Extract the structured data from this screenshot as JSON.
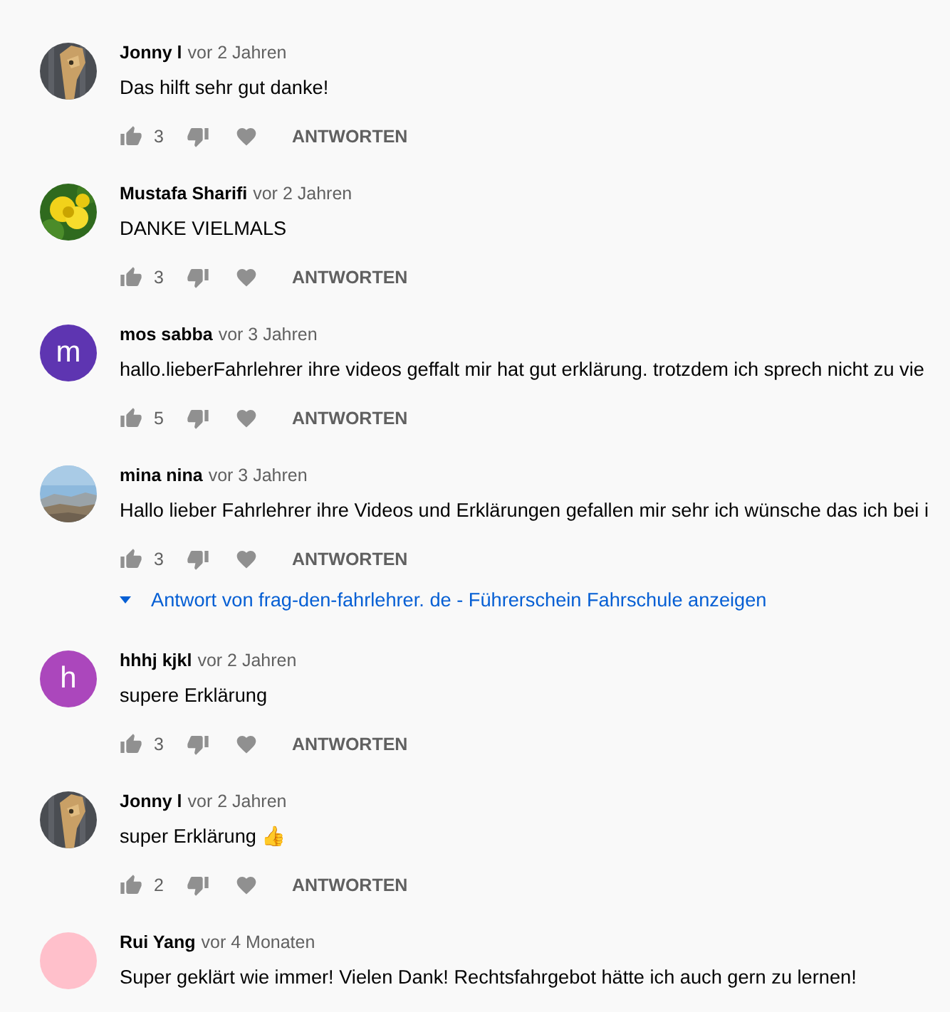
{
  "comments": [
    {
      "author": "Jonny l",
      "time": "vor 2 Jahren",
      "text": "Das hilft sehr gut danke!",
      "likes": "3",
      "reply_label": "ANTWORTEN"
    },
    {
      "author": "Mustafa Sharifi",
      "time": "vor 2 Jahren",
      "text": "DANKE VIELMALS",
      "likes": "3",
      "reply_label": "ANTWORTEN"
    },
    {
      "author": "mos sabba",
      "time": "vor 3 Jahren",
      "text": "hallo.lieberFahrlehrer ihre videos geffalt mir hat gut erklärung. trotzdem ich sprech nicht zu vie",
      "avatar": {
        "kind": "letter",
        "letter": "m",
        "color": "#5e35b1"
      },
      "likes": "5",
      "reply_label": "ANTWORTEN"
    },
    {
      "author": "mina nina",
      "time": "vor 3 Jahren",
      "text": "Hallo lieber Fahrlehrer  ihre Videos und Erklärungen gefallen mir sehr ich wünsche das ich bei i",
      "likes": "3",
      "reply_label": "ANTWORTEN",
      "replies_link": "Antwort von frag-den-fahrlehrer. de - Führerschein Fahrschule anzeigen"
    },
    {
      "author": "hhhj kjkl",
      "time": "vor 2 Jahren",
      "text": "supere Erklärung",
      "avatar": {
        "kind": "letter",
        "letter": "h",
        "color": "#ab47bc"
      },
      "likes": "3",
      "reply_label": "ANTWORTEN"
    },
    {
      "author": "Jonny l",
      "time": "vor 2 Jahren",
      "text": "super Erklärung 👍",
      "likes": "2",
      "reply_label": "ANTWORTEN"
    },
    {
      "author": "Rui Yang",
      "time": "vor 4 Monaten",
      "text": "Super geklärt wie immer! Vielen Dank! Rechtsfahrgebot hätte ich auch gern zu lernen!",
      "avatar": {
        "kind": "plain",
        "color": "#ffc0cb"
      }
    }
  ]
}
